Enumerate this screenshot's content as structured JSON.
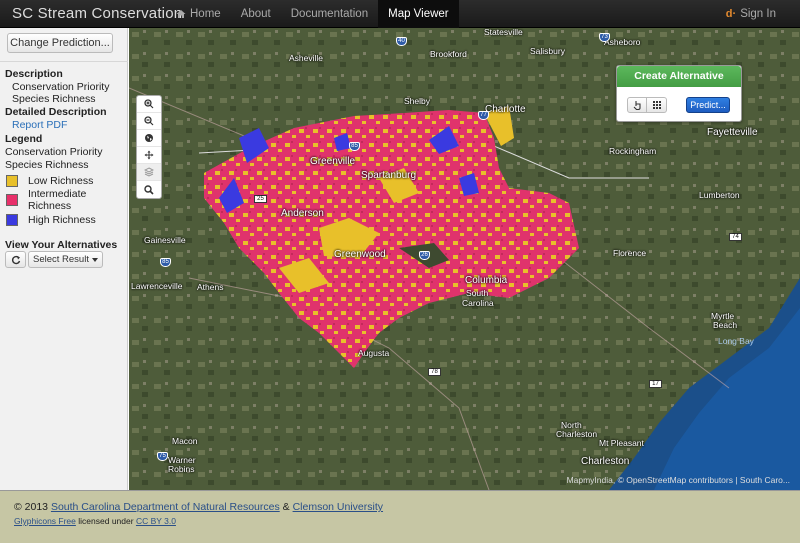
{
  "app": {
    "title": "SC Stream Conservation"
  },
  "nav": {
    "home": "Home",
    "about": "About",
    "documentation": "Documentation",
    "map_viewer": "Map Viewer",
    "sign_in": "Sign In"
  },
  "sidebar": {
    "change_button": "Change Prediction...",
    "description_heading": "Description",
    "description_line1": "Conservation Priority",
    "description_line2": "Species Richness",
    "detailed_heading": "Detailed Description",
    "report_link": "Report PDF",
    "legend_heading": "Legend",
    "legend_title1": "Conservation Priority",
    "legend_title2": "Species Richness",
    "legend": [
      {
        "label": "Low Richness",
        "color": "#e8c02a"
      },
      {
        "label": "Intermediate",
        "label2": "Richness",
        "color": "#e8306a"
      },
      {
        "label": "High Richness",
        "color": "#3a3ae0"
      }
    ],
    "alternatives_heading": "View Your Alternatives",
    "select_result": "Select Result"
  },
  "create_panel": {
    "title": "Create Alternative",
    "predict": "Predict..."
  },
  "map": {
    "attribution": "MapmyIndia, © OpenStreetMap contributors | South Caro...",
    "labels": {
      "charlotte": "Charlotte",
      "spartanburg": "Spartanburg",
      "greenville": "Greenville",
      "anderson": "Anderson",
      "greenwood": "Greenwood",
      "columbia": "Columbia",
      "south_carolina1": "South",
      "south_carolina2": "Carolina",
      "augusta": "Augusta",
      "athens": "Athens",
      "macon": "Macon",
      "warner_robins1": "Warner",
      "warner_robins2": "Robins",
      "florence": "Florence",
      "charleston": "Charleston",
      "north_charleston1": "North",
      "north_charleston2": "Charleston",
      "mt_pleasant": "Mt Pleasant",
      "myrtle_beach1": "Myrtle",
      "myrtle_beach2": "Beach",
      "long_bay": "Long Bay",
      "fayetteville": "Fayetteville",
      "lumberton": "Lumberton",
      "rockingham": "Rockingham",
      "salisbury": "Salisbury",
      "statesville": "Statesville",
      "asheboro": "Asheboro",
      "asheville": "Asheville",
      "brookford": "Brookford",
      "shelby": "Shelby",
      "gainesville": "Gainesville",
      "lawrenceville": "Lawrenceville"
    }
  },
  "footer": {
    "copyright": "© 2013",
    "dnr": "South Carolina Department of Natural Resources",
    "amp": "&",
    "clemson": "Clemson University",
    "glyphicons": "Glyphicons Free",
    "licensed": "licensed under",
    "cc": "CC BY 3.0"
  }
}
